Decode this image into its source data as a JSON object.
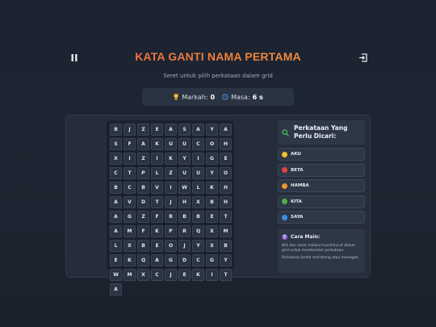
{
  "header": {
    "title": "KATA GANTI NAMA PERTAMA",
    "subtitle": "Seret untuk pilih perkataan dalam grid"
  },
  "stats": {
    "score_label": "Markah:",
    "score_value": "0",
    "time_label": "Masa:",
    "time_value": "6 s"
  },
  "grid": [
    [
      "B",
      "J",
      "Z",
      "E",
      "A",
      "S",
      "A",
      "Y",
      "A",
      "S"
    ],
    [
      "F",
      "A",
      "K",
      "U",
      "U",
      "C",
      "O",
      "H",
      "X",
      "I"
    ],
    [
      "Z",
      "I",
      "K",
      "Y",
      "I",
      "G",
      "E",
      "C",
      "T",
      "P"
    ],
    [
      "L",
      "Z",
      "U",
      "U",
      "Y",
      "O",
      "B",
      "C",
      "B",
      "V"
    ],
    [
      "I",
      "W",
      "L",
      "K",
      "H",
      "A",
      "V",
      "D",
      "T",
      "J"
    ],
    [
      "H",
      "X",
      "B",
      "H",
      "A",
      "G",
      "Z",
      "F",
      "R",
      "B"
    ],
    [
      "B",
      "E",
      "T",
      "A",
      "M",
      "F",
      "K",
      "P",
      "R",
      "Q"
    ],
    [
      "X",
      "M",
      "L",
      "X",
      "B",
      "E",
      "O",
      "J",
      "Y",
      "X"
    ],
    [
      "B",
      "E",
      "K",
      "Q",
      "A",
      "G",
      "D",
      "C",
      "G",
      "Y"
    ],
    [
      "W",
      "M",
      "X",
      "C",
      "J",
      "E",
      "K",
      "I",
      "T",
      "A"
    ]
  ],
  "words_panel": {
    "title": "Perkataan Yang Perlu Dicari:",
    "words": [
      {
        "label": "AKU",
        "color": "#f2c233"
      },
      {
        "label": "BETA",
        "color": "#e0463b"
      },
      {
        "label": "HAMBA",
        "color": "#f0942e"
      },
      {
        "label": "KITA",
        "color": "#52ad4d"
      },
      {
        "label": "SAYA",
        "color": "#3c8fe0"
      }
    ]
  },
  "howto": {
    "title": "Cara Main:",
    "line1": "Klik dan seret melalui huruf-huruf dalam grid untuk membentuk perkataan.",
    "line2": "Perkataan boleh melintang atau menegak."
  },
  "colors": {
    "title_gradient_start": "#ef5a4a",
    "title_gradient_end": "#f0a33a",
    "trophy": "#f2c233",
    "clock": "#4a90e2",
    "search_icon": "#4cc35a",
    "help_icon": "#8f68d8"
  }
}
